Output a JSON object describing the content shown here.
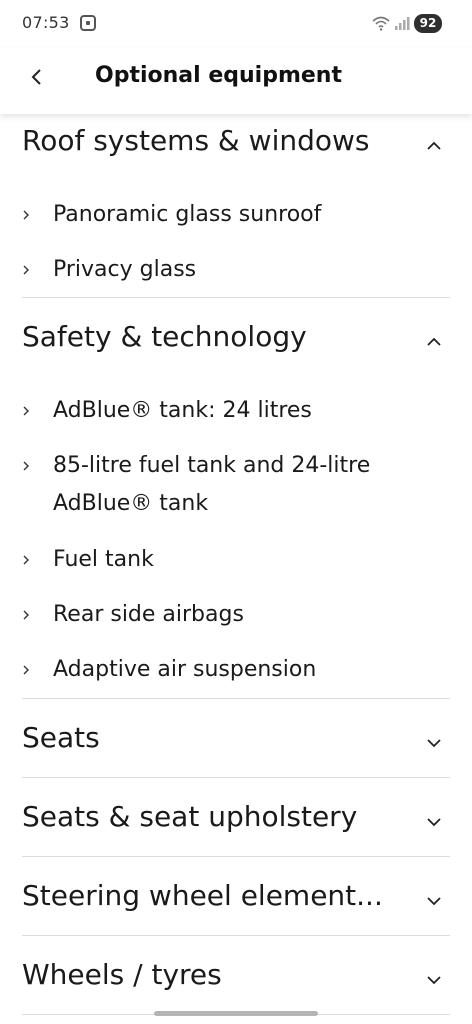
{
  "status_bar": {
    "time": "07:53",
    "battery": "92",
    "wifi_icon": "wifi-icon",
    "signal_icon": "signal-icon"
  },
  "header": {
    "back_icon": "back-chevron-icon",
    "title": "Optional equipment"
  },
  "sections": [
    {
      "title": "Roof systems & windows",
      "expanded": true,
      "items": [
        "Panoramic glass sunroof",
        "Privacy glass"
      ]
    },
    {
      "title": "Safety & technology",
      "expanded": true,
      "items": [
        "AdBlue® tank: 24 litres",
        "85-litre fuel tank and 24-litre AdBlue® tank",
        "Fuel tank",
        "Rear side airbags",
        "Adaptive air suspension"
      ]
    },
    {
      "title": "Seats",
      "expanded": false,
      "items": []
    },
    {
      "title": "Seats & seat upholstery",
      "expanded": false,
      "items": []
    },
    {
      "title": "Steering wheel element...",
      "expanded": false,
      "items": []
    },
    {
      "title": "Wheels / tyres",
      "expanded": false,
      "items": []
    }
  ],
  "colors": {
    "text": "#1a1a1a",
    "divider": "#dcdcdc",
    "battery_badge": "#2f2f2f"
  }
}
